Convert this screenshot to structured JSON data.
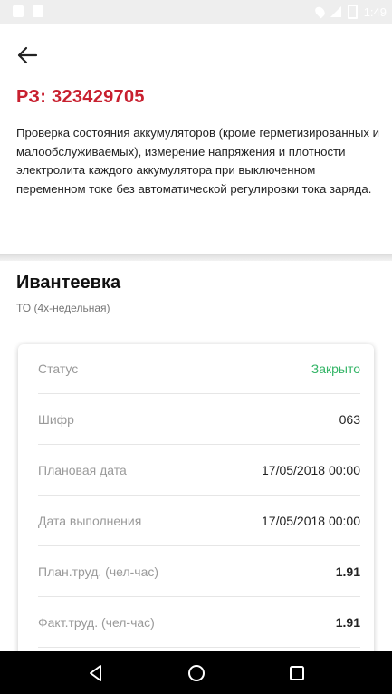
{
  "status_bar": {
    "time": "1:49"
  },
  "header": {
    "back_icon": "arrow-left-icon",
    "title": "РЗ: 323429705",
    "description": "Проверка состояния аккумуляторов (кроме герметизированных и малообслуживаемых), измерение напряжения и плотности электролита каждого аккумулятора при выключенном переменном токе без автоматической регулировки тока заряда."
  },
  "location": {
    "name": "Ивантеевка",
    "type": "ТО (4х-недельная)"
  },
  "details": [
    {
      "label": "Статус",
      "value": "Закрыто"
    },
    {
      "label": "Шифр",
      "value": "063"
    },
    {
      "label": "Плановая дата",
      "value": "17/05/2018 00:00"
    },
    {
      "label": "Дата выполнения",
      "value": "17/05/2018 00:00"
    },
    {
      "label": "План.труд. (чел-час)",
      "value": "1.91"
    },
    {
      "label": "Факт.труд. (чел-час)",
      "value": "1.91"
    }
  ],
  "colors": {
    "title": "#c8202f",
    "status_closed": "#34b567"
  },
  "navbar": {
    "icons": [
      "back-triangle-icon",
      "home-circle-icon",
      "recents-square-icon"
    ]
  }
}
